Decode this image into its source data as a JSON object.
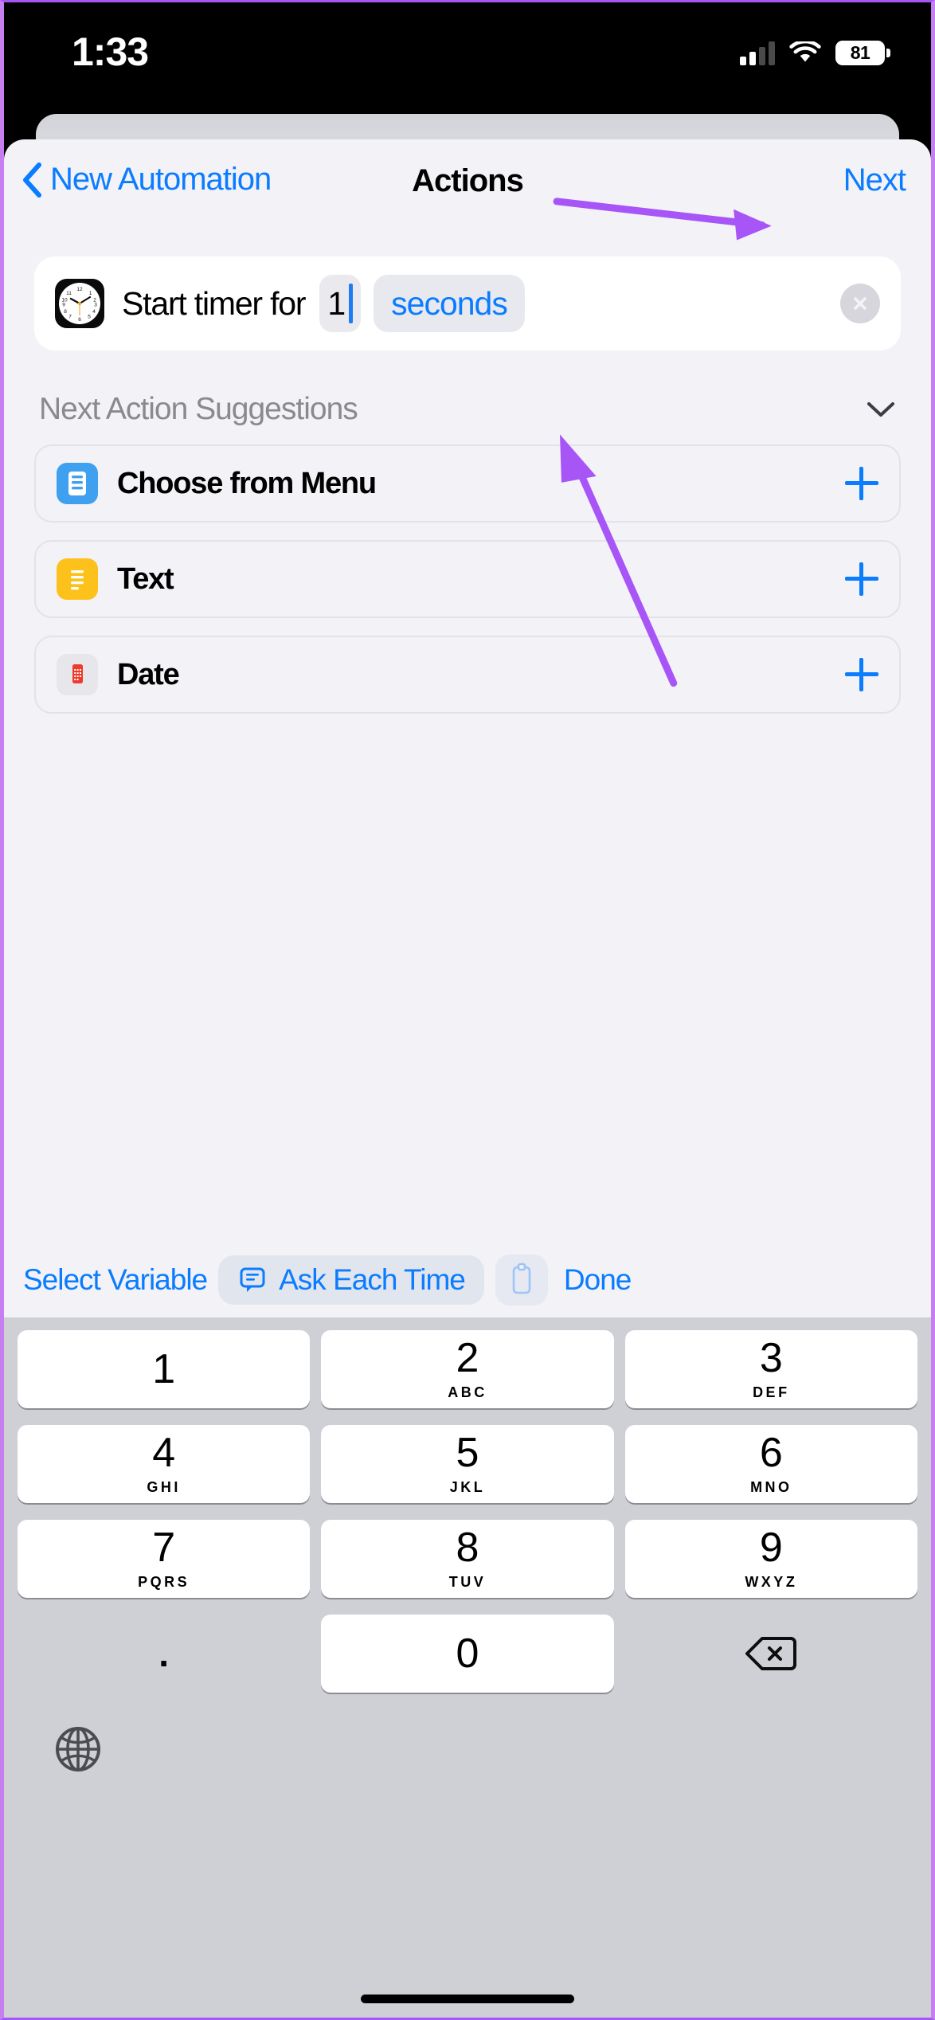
{
  "status_bar": {
    "time": "1:33",
    "battery_level": "81",
    "signal_bars_filled": 2,
    "signal_bars_total": 4,
    "wifi_icon": "wifi-icon",
    "battery_icon": "battery-icon"
  },
  "nav_bar": {
    "back_icon": "chevron-left-icon",
    "back_label": "New Automation",
    "title": "Actions",
    "next_label": "Next"
  },
  "action": {
    "app_icon": "clock-app-icon",
    "text": "Start timer for",
    "value": "1",
    "unit": "seconds",
    "clear_icon": "close-circle-icon"
  },
  "suggestions": {
    "header": "Next Action Suggestions",
    "collapse_icon": "chevron-down-icon",
    "items": [
      {
        "label": "Choose from Menu",
        "icon": "menu-list-icon",
        "icon_color": "#3fa0ef",
        "add_icon": "plus-icon"
      },
      {
        "label": "Text",
        "icon": "text-lines-icon",
        "icon_color": "#fcc21b",
        "add_icon": "plus-icon"
      },
      {
        "label": "Date",
        "icon": "calendar-icon",
        "icon_color": "#f0392b",
        "add_icon": "plus-icon"
      }
    ]
  },
  "variable_toolbar": {
    "select_variable": "Select Variable",
    "ask_each_time": "Ask Each Time",
    "ask_icon": "speech-bubble-icon",
    "clipboard_icon": "clipboard-icon",
    "done": "Done"
  },
  "keypad": {
    "rows": [
      [
        {
          "digit": "1",
          "sub": ""
        },
        {
          "digit": "2",
          "sub": "ABC"
        },
        {
          "digit": "3",
          "sub": "DEF"
        }
      ],
      [
        {
          "digit": "4",
          "sub": "GHI"
        },
        {
          "digit": "5",
          "sub": "JKL"
        },
        {
          "digit": "6",
          "sub": "MNO"
        }
      ],
      [
        {
          "digit": "7",
          "sub": "PQRS"
        },
        {
          "digit": "8",
          "sub": "TUV"
        },
        {
          "digit": "9",
          "sub": "WXYZ"
        }
      ]
    ],
    "dot": ".",
    "zero": "0",
    "delete_icon": "backspace-icon",
    "globe_icon": "globe-icon"
  },
  "annotations": {
    "color": "#a855f7",
    "arrow_to_next": "arrow-pointing-to-next-button",
    "arrow_to_unit": "arrow-pointing-to-seconds-field"
  },
  "colors": {
    "accent_blue": "#0a7cff",
    "sheet_bg": "#f2f2f7",
    "keypad_bg": "#ced0d6",
    "annotation_purple": "#a855f7"
  }
}
